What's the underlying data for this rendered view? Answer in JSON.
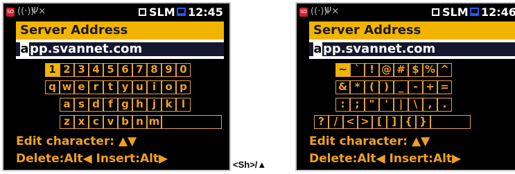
{
  "left": {
    "status": {
      "slm": "SLM",
      "time": "12:45"
    },
    "label": "Server Address",
    "cursor_char": "a",
    "value_rest": "pp.svannet.com",
    "rows": [
      [
        "1",
        "2",
        "3",
        "4",
        "5",
        "6",
        "7",
        "8",
        "9",
        "0"
      ],
      [
        "q",
        "w",
        "e",
        "r",
        "t",
        "y",
        "u",
        "i",
        "o",
        "p"
      ],
      [
        "a",
        "s",
        "d",
        "f",
        "g",
        "h",
        "j",
        "k",
        "l"
      ],
      [
        "z",
        "x",
        "c",
        "v",
        "b",
        "n",
        "m"
      ]
    ],
    "hint_edit": "Edit character: ▲▼",
    "hint_delete": "Delete:Alt◀ Insert:Alt▶"
  },
  "right": {
    "status": {
      "slm": "SLM",
      "time": "12:46"
    },
    "label": "Server Address",
    "cursor_char": "a",
    "value_rest": "pp.svannet.com",
    "rows": [
      [
        "~",
        "`",
        "!",
        "@",
        "#",
        "$",
        "%",
        "^"
      ],
      [
        "&",
        "*",
        "(",
        ")",
        "_",
        "-",
        "+",
        "="
      ],
      [
        ":",
        ";",
        "\"",
        "'",
        "|",
        "\\",
        ",",
        "."
      ],
      [
        "?",
        "/",
        "<",
        ">",
        "[",
        "]",
        "{",
        "}"
      ]
    ],
    "hint_edit": "Edit character: ▲▼",
    "hint_delete": "Delete:Alt◀ Insert:Alt▶"
  },
  "between_label": "<Sh>/▲",
  "colors": {
    "accent": "#f2b400",
    "key_border": "#e6a23c",
    "key_text": "#f0a020",
    "screen_bg": "#000000"
  },
  "icons": [
    "sd-card-icon",
    "wifi-icon",
    "antenna-icon",
    "slm-box-icon",
    "monitor-icon"
  ]
}
